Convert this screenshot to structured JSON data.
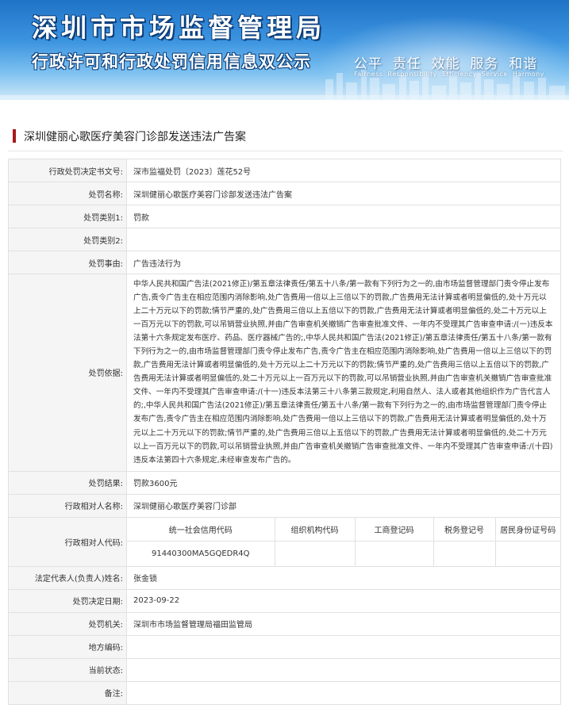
{
  "banner": {
    "title": "深圳市市场监督管理局",
    "subtitle": "行政许可和行政处罚信用信息双公示",
    "values_cn": "公平  责任  效能  服务  和谐",
    "values_en": "Fairness  Responsibility  Efficiency  Service  Harmony"
  },
  "case_title": "深圳健丽心歌医疗美容门诊部发送违法广告案",
  "fields": {
    "decision_no": {
      "label": "行政处罚决定书文号:",
      "value": "深市监福处罚〔2023〕莲花52号"
    },
    "penalty_name": {
      "label": "处罚名称:",
      "value": "深圳健丽心歌医疗美容门诊部发送违法广告案"
    },
    "category1": {
      "label": "处罚类别1:",
      "value": "罚款"
    },
    "category2": {
      "label": "处罚类别2:",
      "value": ""
    },
    "reason": {
      "label": "处罚事由:",
      "value": "广告违法行为"
    },
    "basis": {
      "label": "处罚依据:",
      "value": "中华人民共和国广告法(2021修正)/第五章法律责任/第五十八条/第一款有下列行为之一的,由市场监督管理部门责令停止发布广告,责令广告主在相应范围内消除影响,处广告费用一倍以上三倍以下的罚款,广告费用无法计算或者明显偏低的,处十万元以上二十万元以下的罚款;情节严重的,处广告费用三倍以上五倍以下的罚款,广告费用无法计算或者明显偏低的,处二十万元以上一百万元以下的罚款,可以吊销营业执照,并由广告审查机关撤销广告审查批准文件、一年内不受理其广告审查申请:/(一)违反本法第十六条规定发布医疗、药品、医疗器械广告的;,中华人民共和国广告法(2021修正)/第五章法律责任/第五十八条/第一款有下列行为之一的,由市场监督管理部门责令停止发布广告,责令广告主在相应范围内消除影响,处广告费用一倍以上三倍以下的罚款,广告费用无法计算或者明显偏低的,处十万元以上二十万元以下的罚款;情节严重的,处广告费用三倍以上五倍以下的罚款,广告费用无法计算或者明显偏低的,处二十万元以上一百万元以下的罚款,可以吊销营业执照,并由广告审查机关撤销广告审查批准文件、一年内不受理其广告审查申请:/(十一)违反本法第三十八条第三款规定,利用自然人、法人或者其他组织作为广告代言人的;,中华人民共和国广告法(2021修正)/第五章法律责任/第五十八条/第一款有下列行为之一的,由市场监督管理部门责令停止发布广告,责令广告主在相应范围内消除影响,处广告费用一倍以上三倍以下的罚款,广告费用无法计算或者明显偏低的,处十万元以上二十万元以下的罚款;情节严重的,处广告费用三倍以上五倍以下的罚款,广告费用无法计算或者明显偏低的,处二十万元以上一百万元以下的罚款,可以吊销营业执照,并由广告审查机关撤销广告审查批准文件、一年内不受理其广告审查申请:/(十四)违反本法第四十六条规定,未经审查发布广告的。"
    },
    "result": {
      "label": "处罚结果:",
      "value": "罚款3600元"
    },
    "counterpart_name": {
      "label": "行政相对人名称:",
      "value": "深圳健丽心歌医疗美容门诊部"
    },
    "counterpart_code": {
      "label": "行政相对人代码:",
      "headers": [
        "统一社会信用代码",
        "组织机构代码",
        "工商登记码",
        "税务登记号",
        "居民身份证号码"
      ],
      "values": [
        "91440300MA5GQEDR4Q",
        "",
        "",
        "",
        ""
      ]
    },
    "legal_rep": {
      "label": "法定代表人(负责人)姓名:",
      "value": "张金锁"
    },
    "decision_date": {
      "label": "处罚决定日期:",
      "value": "2023-09-22"
    },
    "authority": {
      "label": "处罚机关:",
      "value": "深圳市市场监督管理局福田监管局"
    },
    "local_code": {
      "label": "地方编码:",
      "value": ""
    },
    "status": {
      "label": "当前状态:",
      "value": ""
    },
    "remarks": {
      "label": "备注:",
      "value": ""
    }
  }
}
